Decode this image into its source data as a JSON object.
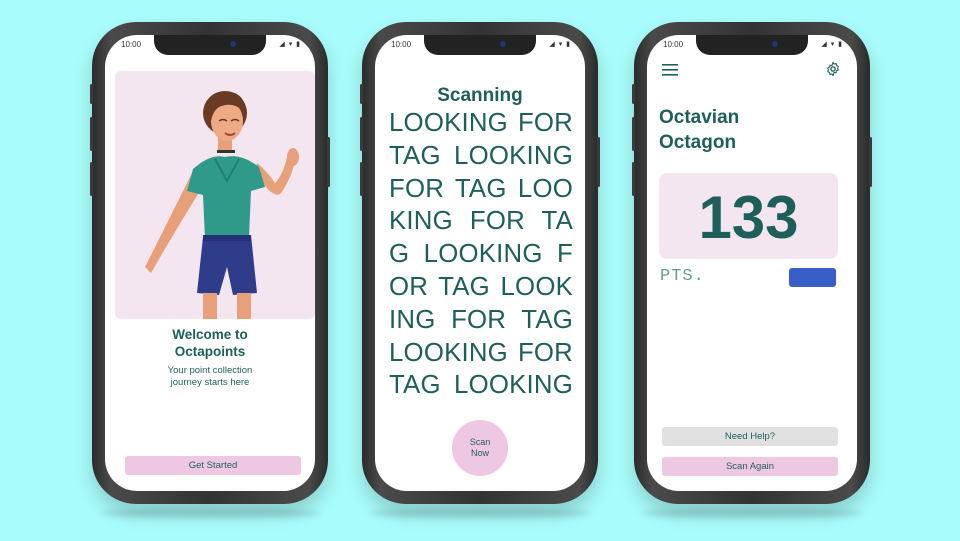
{
  "status": {
    "time": "10:00",
    "icons": "◢ ▾ ▮"
  },
  "welcome": {
    "title": "Welcome to\nOctapoints",
    "subtitle": "Your point collection\njourney starts here",
    "button": "Get Started"
  },
  "scanning": {
    "title": "Scanning",
    "lines": [
      "LOOKING FOR",
      "TAG LOOKING",
      "FOR TAG LOO",
      "KING FOR TA",
      "G LOOKING F",
      "OR TAG LOOK",
      "ING FOR TAG",
      "LOOKING FOR",
      "TAG LOOKING"
    ],
    "button": "Scan\nNow"
  },
  "profile": {
    "name": "Octavian\nOctagon",
    "points": "133",
    "points_unit": "PTS.",
    "help_button": "Need Help?",
    "scan_again_button": "Scan Again"
  },
  "icons": {
    "menu": "menu-icon",
    "settings": "gear-icon",
    "illustration": "woman-illustration"
  },
  "colors": {
    "background": "#a8fcfb",
    "primary_text": "#1f5f5a",
    "pink_button": "#eec8e3",
    "card": "#f4e6f1",
    "accent_blue": "#3a5ec7"
  }
}
